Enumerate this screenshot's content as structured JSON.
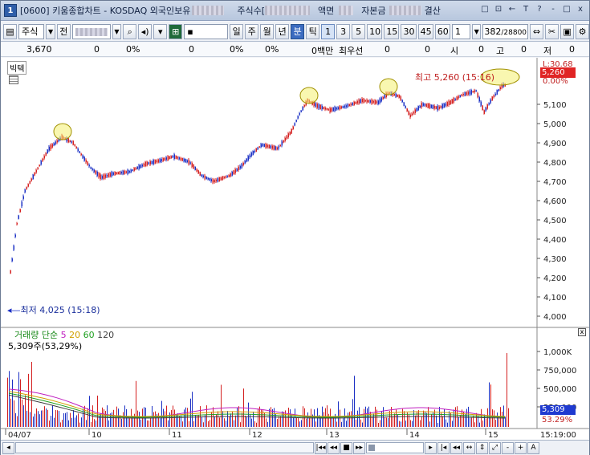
{
  "titlebar": {
    "app_number": "1",
    "title": "[0600] 키움종합차트 - KOSDAQ 외국인보유",
    "shares_label": "주식수[",
    "face_label": "액면",
    "capital_label": "자본금",
    "settle_label": "결산",
    "buttons": [
      "□",
      "⊡",
      "←",
      "T",
      "?",
      "-",
      "□",
      "x"
    ]
  },
  "toolbar": {
    "market_select": "주식",
    "prev_label": "전",
    "code_value": "",
    "period_buttons": [
      "일",
      "주",
      "월",
      "년",
      "분",
      "틱"
    ],
    "active_period": "분",
    "minute_buttons": [
      "1",
      "3",
      "5",
      "10",
      "15",
      "30",
      "45",
      "60"
    ],
    "active_minute": "1",
    "unit_value": "1",
    "count_value": "382",
    "total_value": "/28800"
  },
  "inforow": {
    "price": "3,670",
    "change": "0",
    "change_pct": "0%",
    "val3": "0",
    "val4": "0%",
    "val5": "0%",
    "amount": "0백만",
    "pref_label": "최우선",
    "pref_value": "0",
    "val8": "0",
    "open_label": "시",
    "open_value": "0",
    "high_label": "고",
    "high_value": "0",
    "low_label": "저",
    "low_value": "0"
  },
  "chart": {
    "panel_name": "빅텍",
    "high_label": "최고 5,260 (15:16)",
    "low_label": "최저 4,025 (15:18)",
    "current_price": "5,260",
    "pct_top": "L:30.68",
    "pct_zero": "0.00%",
    "price_ticks": [
      "5,100",
      "5,000",
      "4,900",
      "4,800",
      "4,700",
      "4,600",
      "4,500",
      "4,400",
      "4,300",
      "4,200",
      "4,100",
      "4,000"
    ],
    "volume_legend": {
      "title": "거래량",
      "type": "단순",
      "ma": [
        {
          "label": "5",
          "color": "#c020c0"
        },
        {
          "label": "20",
          "color": "#d0a000"
        },
        {
          "label": "60",
          "color": "#20a020"
        },
        {
          "label": "120",
          "color": "#404040"
        }
      ]
    },
    "volume_value": "5,309주(53,29%)",
    "volume_ticks": [
      "1,000K",
      "750,000",
      "500,000",
      "250,000"
    ],
    "volume_current": "5,309",
    "volume_pct": "53.29%",
    "date_ticks": [
      "04/07",
      "10",
      "11",
      "12",
      "13",
      "14",
      "15"
    ],
    "time_label": "15:19:00",
    "colors": {
      "up": "#d42020",
      "down": "#1a2fc4",
      "highlight": "#f4f070"
    }
  },
  "bottombar": {
    "buttons": [
      "◂",
      "|◂◂",
      "◂◂",
      "■",
      "▸▸",
      "|",
      "▸",
      "|◂",
      "◂◂",
      "↔",
      "⇕",
      "⤢",
      "-",
      "+",
      "A"
    ]
  }
}
